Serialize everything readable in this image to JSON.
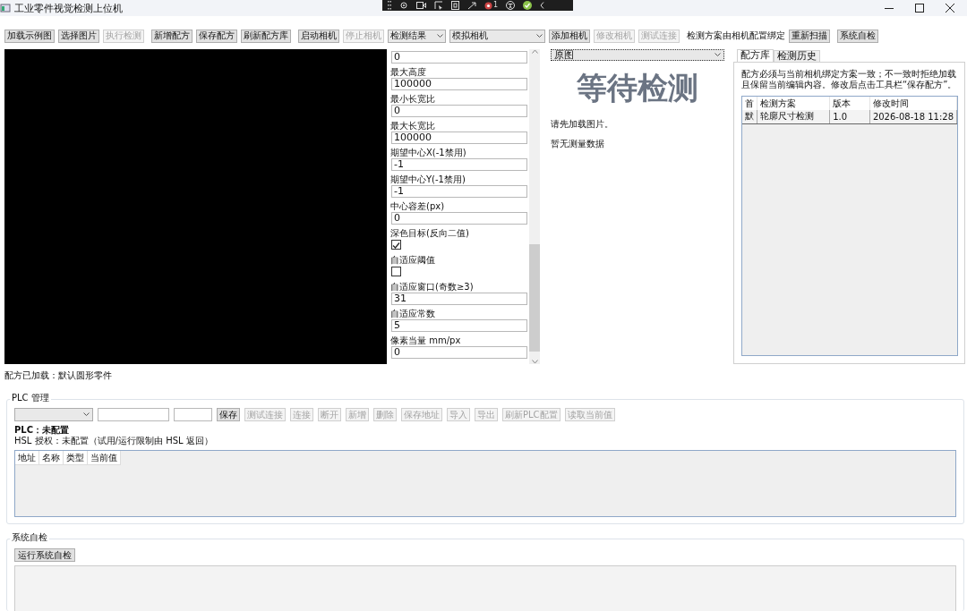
{
  "window": {
    "title": "工业零件视觉检测上位机"
  },
  "capture_bar": {
    "badge": "1"
  },
  "toolbar": {
    "groups": [
      [
        {
          "kind": "button",
          "label": "加载示例图",
          "disabled": false
        },
        {
          "kind": "button",
          "label": "选择图片",
          "disabled": false
        },
        {
          "kind": "button",
          "label": "执行检测",
          "disabled": true
        }
      ],
      [
        {
          "kind": "button",
          "label": "新增配方",
          "disabled": false
        },
        {
          "kind": "button",
          "label": "保存配方",
          "disabled": false
        },
        {
          "kind": "button",
          "label": "刷新配方库",
          "disabled": false
        }
      ],
      [
        {
          "kind": "button",
          "label": "启动相机",
          "disabled": false
        },
        {
          "kind": "button",
          "label": "停止相机",
          "disabled": true
        },
        {
          "kind": "combo",
          "value": "检测结果"
        },
        {
          "kind": "combo",
          "value": "模拟相机"
        },
        {
          "kind": "button",
          "label": "添加相机",
          "disabled": false
        },
        {
          "kind": "button",
          "label": "修改相机",
          "disabled": true
        },
        {
          "kind": "button",
          "label": "测试连接",
          "disabled": true
        }
      ],
      [
        {
          "kind": "label",
          "label": "检测方案由相机配置绑定"
        },
        {
          "kind": "button",
          "label": "重新扫描",
          "disabled": false
        }
      ],
      [
        {
          "kind": "button",
          "label": "系统自检",
          "disabled": false
        }
      ]
    ]
  },
  "params": [
    {
      "kind": "text",
      "value": "0"
    },
    {
      "kind": "text",
      "label": "最大高度",
      "value": "100000"
    },
    {
      "kind": "text",
      "label": "最小长宽比",
      "value": "0"
    },
    {
      "kind": "text",
      "label": "最大长宽比",
      "value": "100000"
    },
    {
      "kind": "text",
      "label": "期望中心X(-1禁用)",
      "value": "-1"
    },
    {
      "kind": "text",
      "label": "期望中心Y(-1禁用)",
      "value": "-1"
    },
    {
      "kind": "text",
      "label": "中心容差(px)",
      "value": "0"
    },
    {
      "kind": "checkbox",
      "label": "深色目标(反向二值)",
      "checked": true
    },
    {
      "kind": "checkbox",
      "label": "自适应阈值",
      "checked": false
    },
    {
      "kind": "text",
      "label": "自适应窗口(奇数≥3)",
      "value": "31"
    },
    {
      "kind": "text",
      "label": "自适应常数",
      "value": "5"
    },
    {
      "kind": "text",
      "label": "像素当量 mm/px",
      "value": "0"
    }
  ],
  "result": {
    "view_mode": "原图",
    "status": "等待检测",
    "message": "请先加载图片。",
    "measurements": "暂无测量数据"
  },
  "recipe_panel": {
    "tabs": [
      {
        "label": "配方库",
        "selected": true
      },
      {
        "label": "检测历史",
        "selected": false
      }
    ],
    "note": "配方必须与当前相机绑定方案一致；不一致时拒绝加载且保留当前编辑内容。修改后点击工具栏“保存配方”。",
    "columns": [
      "首",
      "检测方案",
      "版本",
      "修改时间"
    ],
    "rows": [
      [
        "默",
        "轮廓尺寸检测",
        "1.0",
        "2026-08-18 11:28"
      ]
    ]
  },
  "status_text": "配方已加载：默认圆形零件",
  "plc": {
    "title": "PLC 管理",
    "controls": [
      {
        "kind": "combo"
      },
      {
        "kind": "input"
      },
      {
        "kind": "input"
      },
      {
        "kind": "button",
        "label": "保存",
        "disabled": false
      },
      {
        "kind": "button",
        "label": "测试连接",
        "disabled": true
      },
      {
        "kind": "button",
        "label": "连接",
        "disabled": true
      },
      {
        "kind": "button",
        "label": "断开",
        "disabled": true
      },
      {
        "kind": "button",
        "label": "新增",
        "disabled": true
      },
      {
        "kind": "button",
        "label": "删除",
        "disabled": true
      },
      {
        "kind": "button",
        "label": "保存地址",
        "disabled": true
      },
      {
        "kind": "button",
        "label": "导入",
        "disabled": true
      },
      {
        "kind": "button",
        "label": "导出",
        "disabled": true
      },
      {
        "kind": "button",
        "label": "刷新PLC配置",
        "disabled": true
      },
      {
        "kind": "button",
        "label": "读取当前值",
        "disabled": true
      }
    ],
    "status": "PLC：未配置",
    "license": "HSL 授权：未配置（试用/运行限制由 HSL 返回）",
    "columns": [
      "地址",
      "名称",
      "类型",
      "当前值"
    ]
  },
  "self_test": {
    "title": "系统自检",
    "button": "运行系统自检"
  }
}
